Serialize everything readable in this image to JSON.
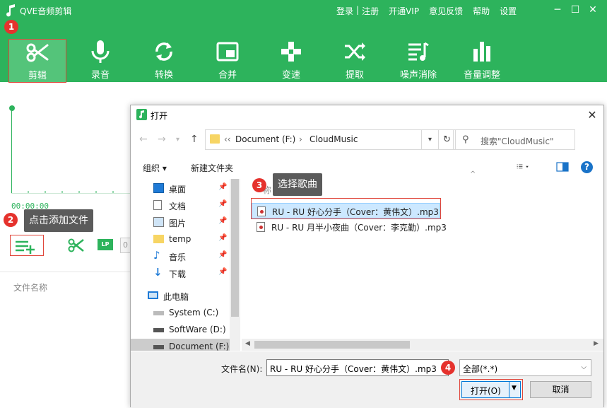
{
  "app": {
    "title": "QVE音频剪辑",
    "links": [
      "登录",
      "|",
      "注册",
      "开通VIP",
      "意见反馈",
      "帮助",
      "设置"
    ],
    "win_min": "─",
    "win_max": "☐",
    "win_close": "✕",
    "toolbar": [
      {
        "label": "剪辑",
        "icon": "scissors-icon"
      },
      {
        "label": "录音",
        "icon": "microphone-icon"
      },
      {
        "label": "转换",
        "icon": "convert-icon"
      },
      {
        "label": "合并",
        "icon": "merge-icon"
      },
      {
        "label": "变速",
        "icon": "speed-icon"
      },
      {
        "label": "提取",
        "icon": "extract-icon"
      },
      {
        "label": "噪声消除",
        "icon": "noise-icon"
      },
      {
        "label": "音量调整",
        "icon": "volume-icon"
      }
    ],
    "time": "00:00:00",
    "lp_label": "LP",
    "partial_value": "0",
    "file_col": "文件名称",
    "accent": "#2db35c"
  },
  "annotations": {
    "b1": "1",
    "b2": "2",
    "b3": "3",
    "b4": "4",
    "tip2": "点击添加文件",
    "tip3": "选择歌曲",
    "badge_color": "#e5322d"
  },
  "dialog": {
    "title": "打开",
    "close": "✕",
    "path": [
      "‹‹",
      "Document (F:)",
      "›",
      "CloudMusic"
    ],
    "search_placeholder": "搜索\"CloudMusic\"",
    "organize": "组织 ▾",
    "new_folder": "新建文件夹",
    "nav": [
      {
        "label": "桌面",
        "icon": "desktop-icon",
        "pin": true
      },
      {
        "label": "文档",
        "icon": "document-icon",
        "pin": true
      },
      {
        "label": "图片",
        "icon": "picture-icon",
        "pin": true
      },
      {
        "label": "temp",
        "icon": "folder-icon",
        "pin": true
      },
      {
        "label": "音乐",
        "icon": "music-icon",
        "pin": true
      },
      {
        "label": "下载",
        "icon": "download-icon",
        "pin": true
      },
      {
        "label": "此电脑",
        "icon": "computer-icon",
        "pin": false
      },
      {
        "label": "System (C:)",
        "icon": "drive-icon",
        "pin": false
      },
      {
        "label": "SoftWare (D:)",
        "icon": "drive-icon",
        "pin": false
      },
      {
        "label": "Document (F:)",
        "icon": "drive-icon",
        "pin": false
      }
    ],
    "col_name": "称",
    "files": [
      "RU - RU 好心分手（Cover：黄伟文）.mp3",
      "RU - RU 月半小夜曲（Cover：李克勤）.mp3"
    ],
    "filename_label": "文件名(N):",
    "filename_value": "RU - RU 好心分手（Cover：黄伟文）.mp3",
    "filetype": "全部(*.*)",
    "open_label": "打开(O)",
    "cancel_label": "取消"
  }
}
